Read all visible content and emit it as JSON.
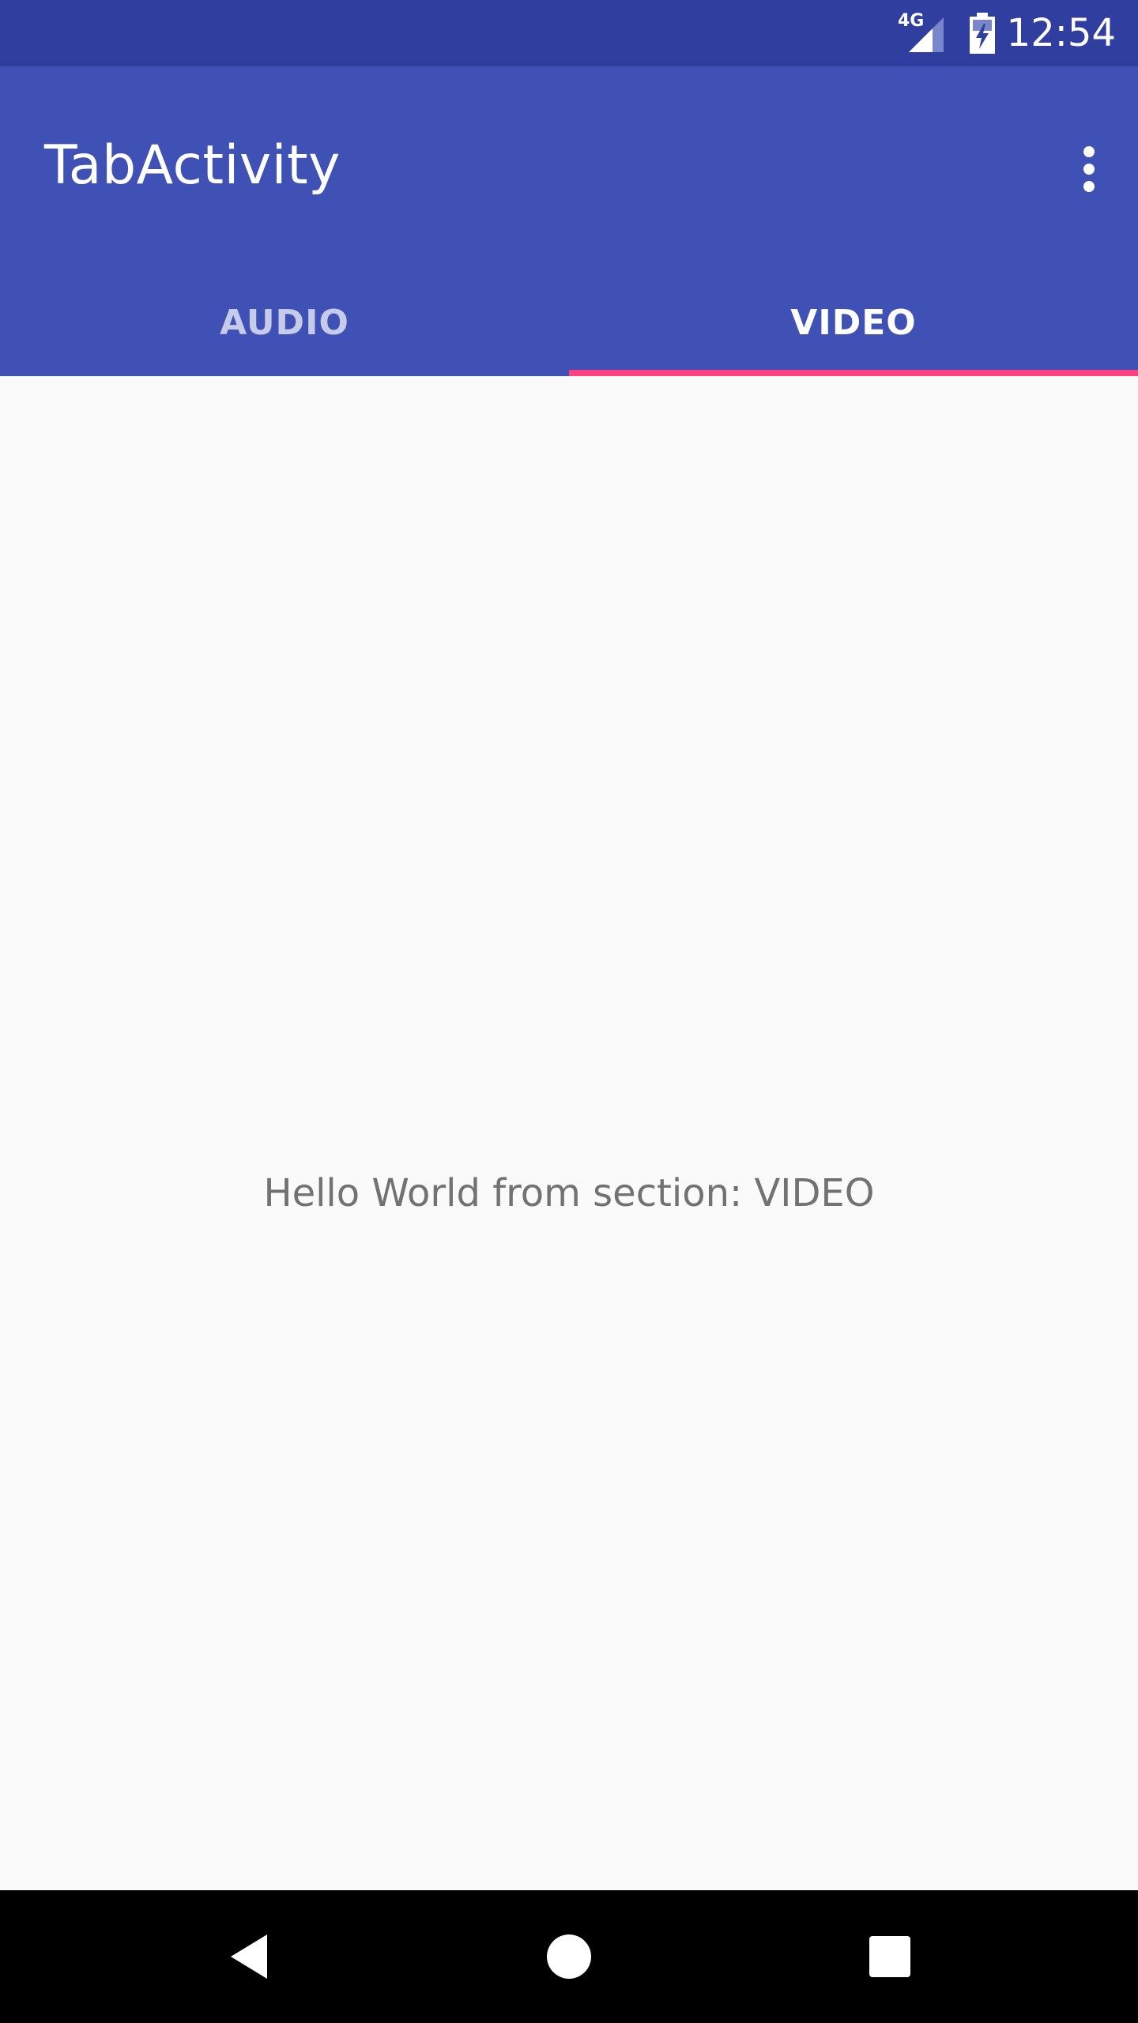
{
  "status_bar": {
    "network_label": "4G",
    "time": "12:54",
    "icons": {
      "signal": "signal-icon",
      "battery": "battery-charging-icon"
    }
  },
  "app_bar": {
    "title": "TabActivity",
    "menu_icon": "overflow-menu-icon",
    "background_color": "#3f51b5",
    "status_bar_color": "#303f9f"
  },
  "tabs": {
    "items": [
      {
        "label": "AUDIO",
        "selected": false
      },
      {
        "label": "VIDEO",
        "selected": true
      }
    ],
    "indicator_color": "#ff4081"
  },
  "content": {
    "message": "Hello World from section: VIDEO"
  },
  "navigation_bar": {
    "icons": [
      "back-icon",
      "home-icon",
      "recents-icon"
    ]
  }
}
